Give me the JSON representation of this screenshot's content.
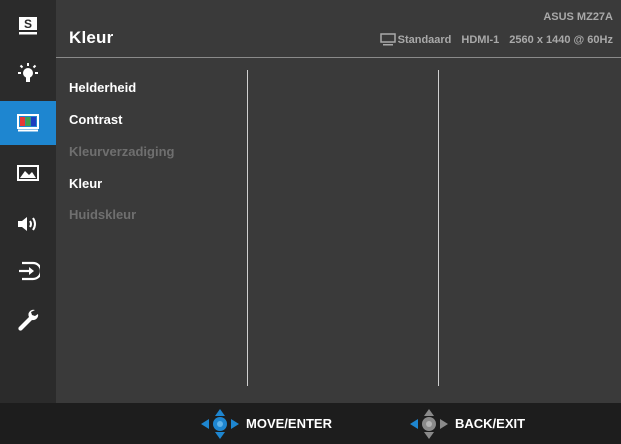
{
  "header": {
    "title": "Kleur",
    "model": "ASUS MZ27A",
    "mode": "Standaard",
    "input": "HDMI-1",
    "resolution": "2560 x 1440 @ 60Hz"
  },
  "sidebar": {
    "items": [
      {
        "name": "splendid",
        "icon": "splendid-s-icon",
        "label": "S"
      },
      {
        "name": "blue-light",
        "icon": "bulb-icon"
      },
      {
        "name": "color",
        "icon": "color-bars-icon",
        "active": true
      },
      {
        "name": "image",
        "icon": "picture-icon"
      },
      {
        "name": "sound",
        "icon": "speaker-icon"
      },
      {
        "name": "input",
        "icon": "input-select-icon"
      },
      {
        "name": "system",
        "icon": "wrench-icon"
      }
    ],
    "active_color": "#1e86d0"
  },
  "menu": {
    "items": [
      {
        "label": "Helderheid",
        "enabled": true
      },
      {
        "label": "Contrast",
        "enabled": true
      },
      {
        "label": "Kleurverzadiging",
        "enabled": false
      },
      {
        "label": "Kleur",
        "enabled": true
      },
      {
        "label": "Huidskleur",
        "enabled": false
      }
    ]
  },
  "footer": {
    "move_label": "MOVE/ENTER",
    "back_label": "BACK/EXIT",
    "accent_color": "#1e86d0"
  }
}
